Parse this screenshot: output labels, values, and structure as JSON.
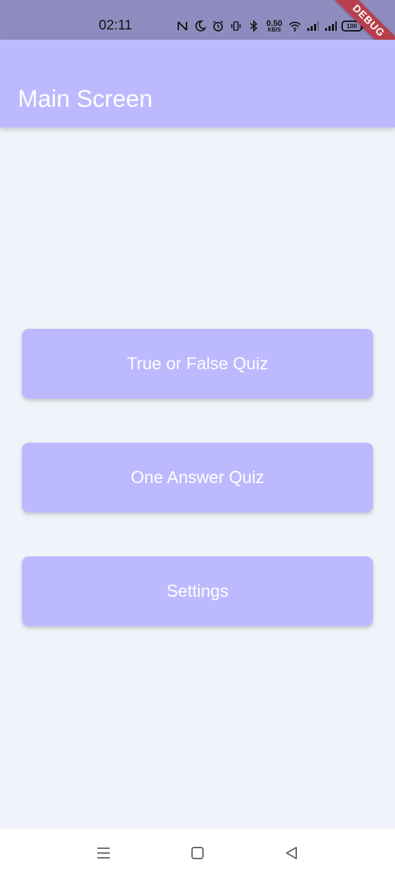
{
  "status_bar": {
    "time": "02:11",
    "net_speed_value": "0.50",
    "net_speed_unit": "KB/S",
    "battery": "100",
    "icons": [
      "nfc-icon",
      "moon-icon",
      "alarm-icon",
      "vibrate-icon",
      "bluetooth-icon",
      "wifi-icon",
      "signal-icon",
      "signal-icon",
      "battery-icon"
    ]
  },
  "debug_banner": "DEBUG",
  "app_bar": {
    "title": "Main Screen"
  },
  "menu": {
    "buttons": [
      {
        "label": "True or False Quiz"
      },
      {
        "label": "One Answer Quiz"
      },
      {
        "label": "Settings"
      }
    ]
  },
  "nav_bar": {
    "icons": [
      "recents-icon",
      "home-icon",
      "back-icon"
    ]
  },
  "colors": {
    "accent": "#bdb9ff",
    "status_bar": "#8f8bbf",
    "background": "#f0f3f9",
    "debug_banner": "#b8404d"
  }
}
